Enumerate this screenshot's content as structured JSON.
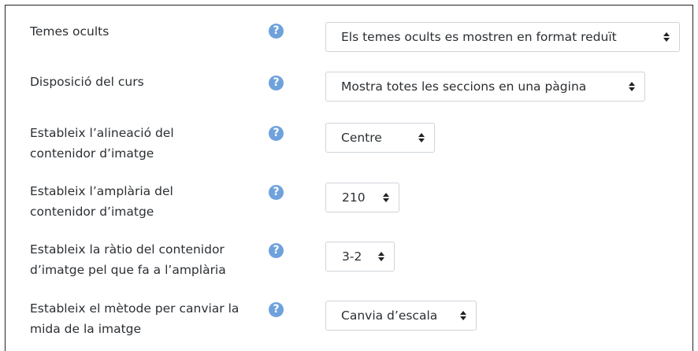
{
  "rows": [
    {
      "label": "Temes ocults",
      "value": "Els temes ocults es mostren en format reduït"
    },
    {
      "label": "Disposició del curs",
      "value": "Mostra totes les seccions en una pàgina"
    },
    {
      "label": "Estableix l’alineació del contenidor d’imatge",
      "value": "Centre"
    },
    {
      "label": "Estableix l’amplària del contenidor d’imatge",
      "value": "210"
    },
    {
      "label": "Estableix la ràtio del contenidor d’imatge pel que fa a l’amplària",
      "value": "3-2"
    },
    {
      "label": "Estableix el mètode per canviar la mida de la imatge",
      "value": "Canvia d’escala"
    }
  ],
  "help_icon": "question-circle-icon",
  "help_glyph": "?",
  "colors": {
    "help": "#6fa2dc",
    "border": "#ced4da",
    "text": "#2b2f33"
  }
}
